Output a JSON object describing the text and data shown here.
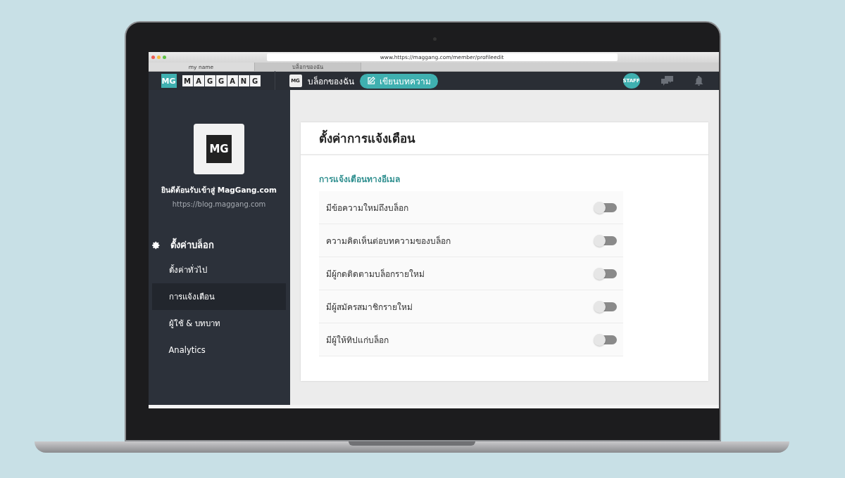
{
  "browser": {
    "url": "www.https://maggang.com/member/profileedit",
    "tabs": [
      {
        "label": "my name",
        "selected": true
      },
      {
        "label": "บล็อกของฉัน",
        "selected": false
      }
    ]
  },
  "header": {
    "logo_mark": "MG",
    "logo_letters": [
      "M",
      "A",
      "G",
      "G",
      "A",
      "N",
      "G"
    ],
    "blog_icon_mark": "MG",
    "blog_link": "บล็อกของฉัน",
    "write_button": "เขียนบทความ",
    "staff_badge": "STAFF"
  },
  "sidebar": {
    "avatar_mark": "MG",
    "welcome": "ยินดีต้อนรับเข้าสู่ MagGang.com",
    "url": "https://blog.maggang.com",
    "section_title": "ตั้งค่าบล็อก",
    "items": [
      {
        "label": "ตั้งค่าทั่วไป",
        "selected": false
      },
      {
        "label": "การแจ้งเตือน",
        "selected": true
      },
      {
        "label": "ผู้ใช้ & บทบาท",
        "selected": false
      },
      {
        "label": "Analytics",
        "selected": false
      }
    ]
  },
  "content": {
    "title": "ตั้งค่าการแจ้งเตือน",
    "subtitle": "การแจ้งเตือนทางอีเมล",
    "settings": [
      {
        "label": "มีข้อความใหม่ถึงบล็อก",
        "on": false
      },
      {
        "label": "ความคิดเห็นต่อบทความของบล็อก",
        "on": false
      },
      {
        "label": "มีผู้กดติดตามบล็อกรายใหม่",
        "on": false
      },
      {
        "label": "มีผู้สมัครสมาชิกรายใหม่",
        "on": false
      },
      {
        "label": "มีผู้ให้ทิปแก่บล็อก",
        "on": false
      }
    ]
  }
}
